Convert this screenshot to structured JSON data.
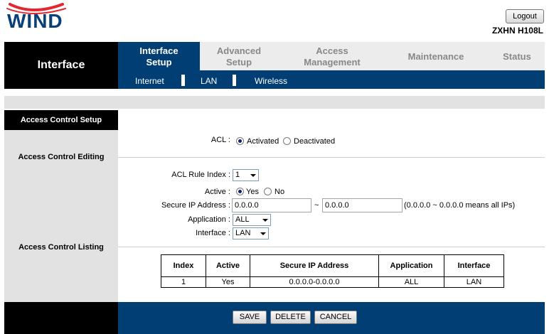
{
  "header": {
    "logo_text": "WIND",
    "logout_label": "Logout",
    "model": "ZXHN H108L"
  },
  "nav": {
    "section_title": "Interface",
    "tabs": [
      {
        "line1": "Interface",
        "line2": "Setup",
        "active": true
      },
      {
        "line1": "Advanced",
        "line2": "Setup",
        "active": false
      },
      {
        "line1": "Access",
        "line2": "Management",
        "active": false
      },
      {
        "line1": "Maintenance",
        "line2": "",
        "active": false
      },
      {
        "line1": "Status",
        "line2": "",
        "active": false
      }
    ],
    "subtabs": [
      "Internet",
      "LAN",
      "Wireless"
    ]
  },
  "left": {
    "setup": "Access Control Setup",
    "editing": "Access Control Editing",
    "listing": "Access Control Listing"
  },
  "acl": {
    "label": "ACL :",
    "activated": "Activated",
    "deactivated": "Deactivated"
  },
  "edit": {
    "rule_index_label": "ACL Rule Index :",
    "rule_index_value": "1",
    "active_label": "Active :",
    "yes": "Yes",
    "no": "No",
    "secure_ip_label": "Secure IP Address :",
    "ip_start": "0.0.0.0",
    "tilde": "~",
    "ip_end": "0.0.0.0",
    "ip_hint": "(0.0.0.0 ~ 0.0.0.0 means all IPs)",
    "application_label": "Application :",
    "application_value": "ALL",
    "interface_label": "Interface :",
    "interface_value": "LAN"
  },
  "table": {
    "headers": [
      "Index",
      "Active",
      "Secure IP Address",
      "Application",
      "Interface"
    ],
    "rows": [
      [
        "1",
        "Yes",
        "0.0.0.0-0.0.0.0",
        "ALL",
        "LAN"
      ]
    ]
  },
  "footer": {
    "save": "SAVE",
    "delete": "DELETE",
    "cancel": "CANCEL"
  },
  "colors": {
    "brand_blue": "#003e73",
    "logo_red": "#e3262f"
  }
}
